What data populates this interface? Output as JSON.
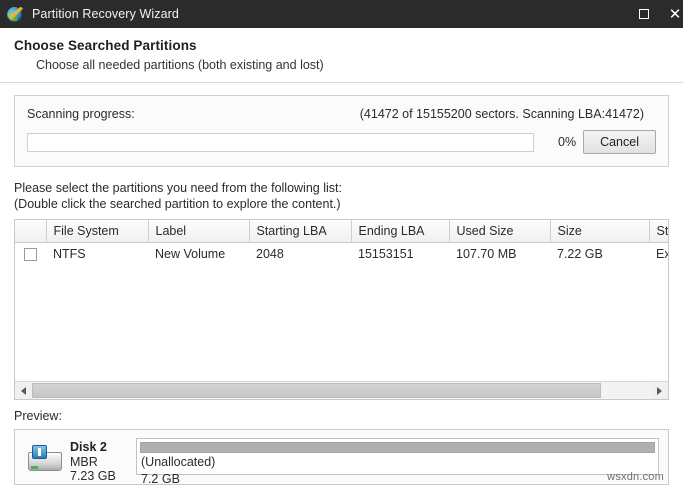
{
  "window": {
    "title": "Partition Recovery Wizard",
    "icon": "wizard-wand-icon",
    "maximize_label": "Maximize",
    "close_label": "Close"
  },
  "header": {
    "title": "Choose Searched Partitions",
    "subtitle": "Choose all needed partitions (both existing and lost)"
  },
  "scan": {
    "label": "Scanning progress:",
    "status": "(41472 of 15155200 sectors. Scanning LBA:41472)",
    "percent_label": "0%",
    "percent_value": 0,
    "cancel_label": "Cancel"
  },
  "instructions": {
    "line1": "Please select the partitions you need from the following list:",
    "line2": "(Double click the searched partition to explore the content.)"
  },
  "table": {
    "columns": [
      "",
      "File System",
      "Label",
      "Starting LBA",
      "Ending LBA",
      "Used Size",
      "Size",
      "Statu"
    ],
    "rows": [
      {
        "checked": false,
        "file_system": "NTFS",
        "label": "New Volume",
        "starting_lba": "2048",
        "ending_lba": "15153151",
        "used_size": "107.70 MB",
        "size": "7.22 GB",
        "status": "Exist"
      }
    ]
  },
  "preview": {
    "label": "Preview:",
    "disk": {
      "name": "Disk 2",
      "scheme": "MBR",
      "capacity": "7.23 GB",
      "icon": "usb-disk-icon"
    },
    "partition": {
      "name": "(Unallocated)",
      "size": "7.2 GB"
    }
  },
  "watermark": "wsxdn.com",
  "colors": {
    "titlebar_bg": "#2b2b2b",
    "accent_disk_usb": "#2d7cb8",
    "unallocated_bar": "#b0b0b0"
  }
}
